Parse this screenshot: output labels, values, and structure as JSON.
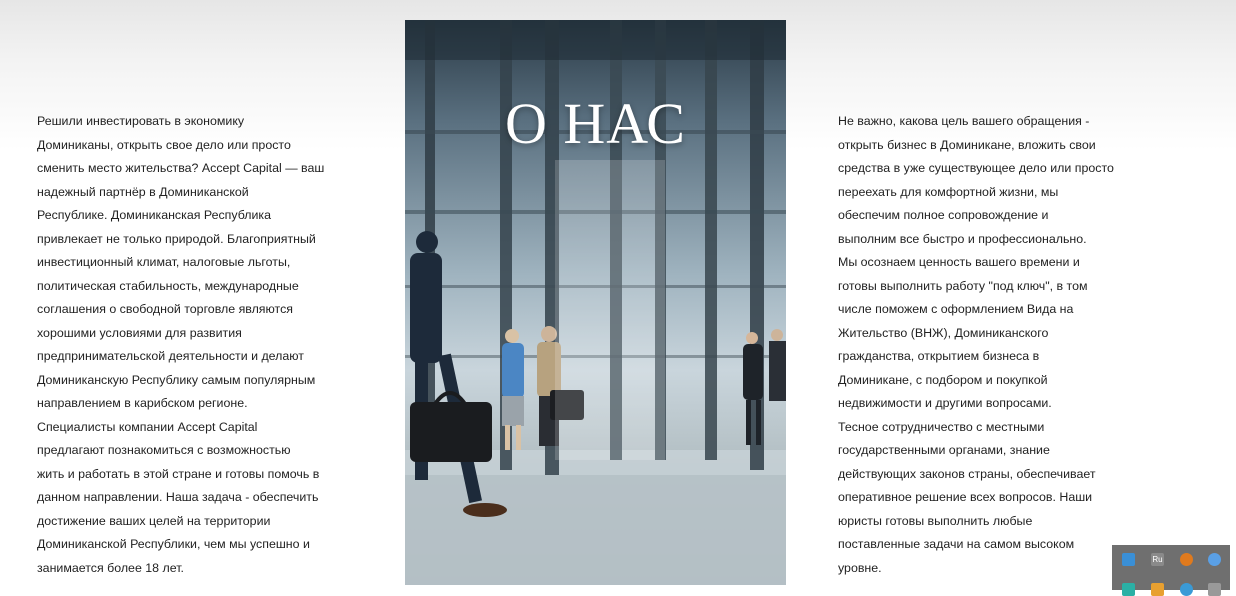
{
  "hero": {
    "title": "О НАС"
  },
  "left_text": "Решили инвестировать в экономику\nДоминиканы, открыть свое дело или просто\nсменить место жительства? Accept Capital — ваш\nнадежный партнёр в Доминиканской\nРеспублике.  Доминиканская Республика\nпривлекает не только природой. Благоприятный\nинвестиционный климат, налоговые льготы,\nполитическая стабильность, международные\nсоглашения о свободной торговле являются\nхорошими условиями для развития\nпредпринимательской деятельности и делают\nДоминиканскую Республику самым популярным\nнаправлением в карибском регионе.\nСпециалисты компании Accept Capital\nпредлагают познакомиться с возможностью\nжить и работать в этой стране и готовы помочь в\nданном направлении. Наша задача - обеспечить\nдостижение ваших целей на территории\nДоминиканской Республики, чем мы успешно и\nзанимается более 18 лет.",
  "right_text": "Не важно, какова цель вашего обращения -\nоткрыть бизнес в Доминикане, вложить свои\nсредства в уже существующее дело или просто\nпереехать для комфортной жизни, мы\nобеспечим полное сопровождение и\nвыполним все быстро и профессионально.\nМы осознаем ценность вашего времени и\nготовы выполнить работу \"под ключ\", в том\nчисле поможем с оформлением Вида на\nЖительство (ВНЖ), Доминиканского\nгражданства, открытием бизнеса в\nДоминикане, с подбором и покупкой\nнедвижимости и другими вопросами.\nТесное сотрудничество с местными\nгосударственными органами, знание\nдействующих законов страны, обеспечивает\nоперативное решение всех вопросов. Наши\nюристы готовы выполнить любые\nпоставленные задачи на самом высоком\nуровне.",
  "tray": {
    "icons": [
      "app-icon",
      "language-icon",
      "firefox-icon",
      "chrome-icon",
      "network-icon",
      "volume-icon",
      "telegram-icon",
      "keyboard-icon"
    ],
    "language_label": "Ru"
  },
  "colors": {
    "text": "#222222",
    "tray_bg": "#6f6f6f"
  }
}
